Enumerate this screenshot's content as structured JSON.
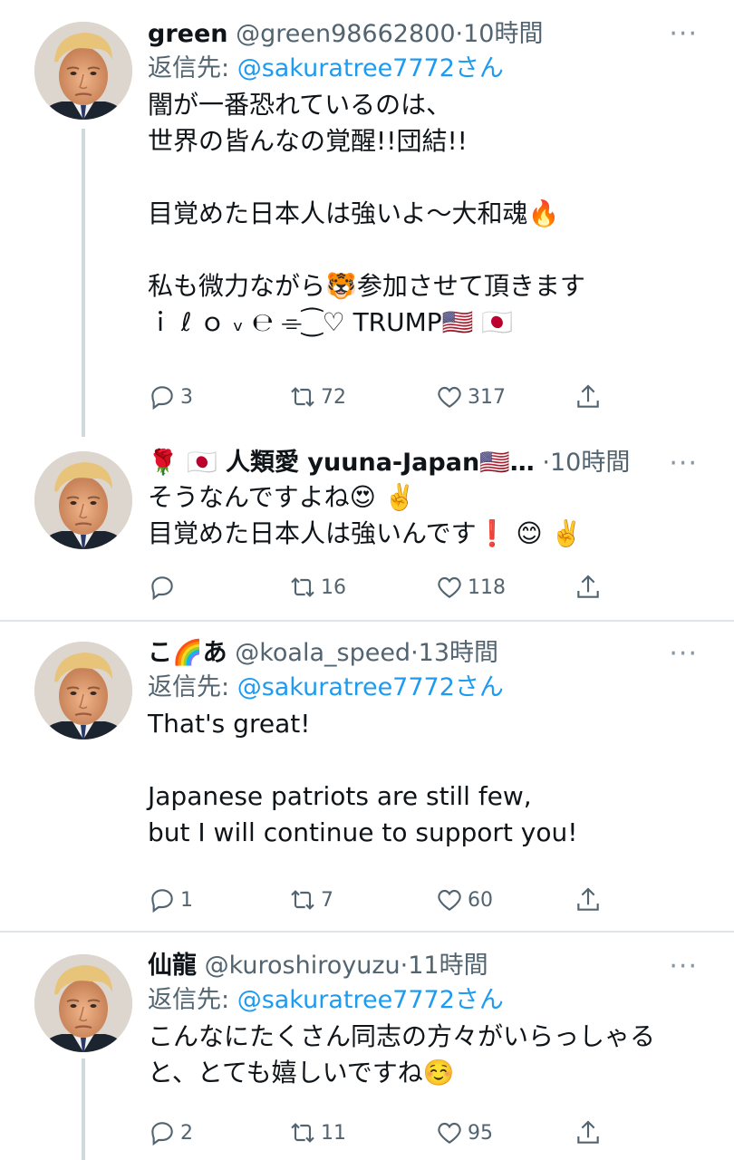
{
  "tweets": [
    {
      "name": "green",
      "handle": "@green98662800",
      "time": "10時間",
      "reply_prefix": "返信先: ",
      "reply_to": "@sakuratree7772さん",
      "lines": [
        "闇が一番恐れているのは、",
        "世界の皆んなの覚醒!!団結!!",
        "",
        "目覚めた日本人は強いよ〜大和魂🔥",
        "",
        "私も微力ながら🐯参加させて頂きます",
        "ｉ ℓ ｏ ᵥ ℮ ⌯⁐♡ TRUMP🇺🇸 🇯🇵"
      ],
      "replies": "3",
      "retweets": "72",
      "likes": "317"
    },
    {
      "name": "🌹 🇯🇵 人類愛 yuuna-Japan🇺🇸…",
      "handle": "",
      "time": "10時間",
      "lines": [
        "そうなんですよね😍 ✌️",
        "目覚めた日本人は強いんです❗ 😊 ✌️"
      ],
      "replies": "",
      "retweets": "16",
      "likes": "118"
    },
    {
      "name": "こ🌈あ",
      "handle": "@koala_speed",
      "time": "13時間",
      "reply_prefix": "返信先: ",
      "reply_to": "@sakuratree7772さん",
      "lines": [
        "That's great!",
        "",
        "Japanese patriots are still few,",
        "but I will continue to support you!"
      ],
      "replies": "1",
      "retweets": "7",
      "likes": "60"
    },
    {
      "name": "仙龍",
      "handle": "@kuroshiroyuzu",
      "time": "11時間",
      "reply_prefix": "返信先: ",
      "reply_to": "@sakuratree7772さん",
      "lines": [
        "こんなにたくさん同志の方々がいらっしゃる",
        "と、とても嬉しいですね☺️"
      ],
      "replies": "2",
      "retweets": "11",
      "likes": "95"
    }
  ],
  "more_glyph": "···",
  "dot": "·",
  "icons": [
    "reply-icon",
    "retweet-icon",
    "like-icon",
    "share-icon",
    "more-icon"
  ],
  "colors": {
    "mention": "#1d9bf0",
    "secondary": "#536471",
    "thread_line": "#cfd9de"
  }
}
